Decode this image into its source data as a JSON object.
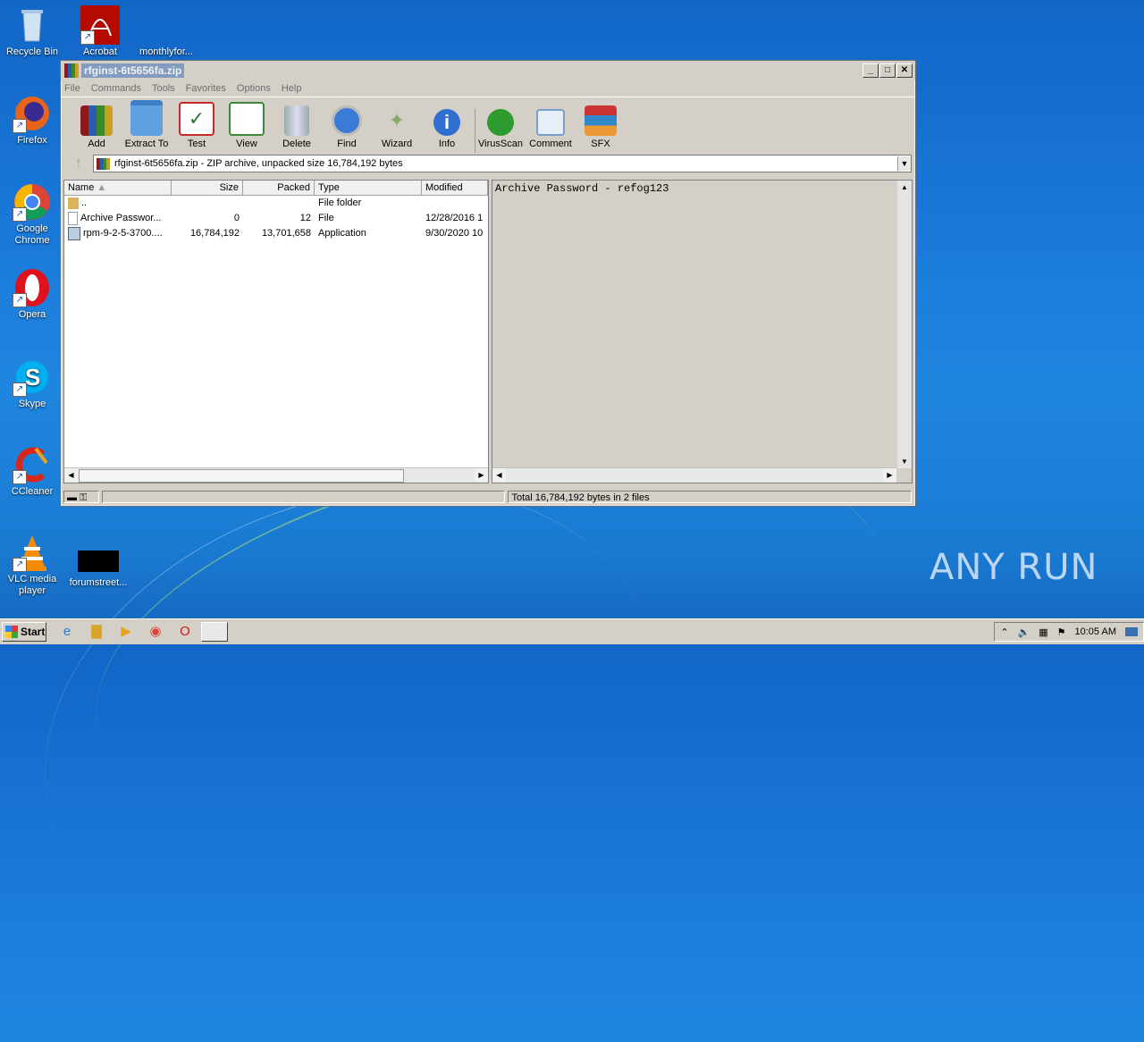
{
  "desktop": {
    "icons": [
      {
        "label": "Recycle Bin",
        "icon": "recycle-bin-icon"
      },
      {
        "label": "Acrobat",
        "icon": "acrobat-icon"
      },
      {
        "label": "monthlyfor...",
        "icon": "document-icon"
      },
      {
        "label": "Firefox",
        "icon": "firefox-icon"
      },
      {
        "label": "Google Chrome",
        "icon": "chrome-icon"
      },
      {
        "label": "Opera",
        "icon": "opera-icon"
      },
      {
        "label": "Skype",
        "icon": "skype-icon"
      },
      {
        "label": "CCleaner",
        "icon": "ccleaner-icon"
      },
      {
        "label": "VLC media player",
        "icon": "vlc-icon"
      },
      {
        "label": "forumstreet...",
        "icon": "black-file-icon"
      }
    ],
    "watermark": "ANY RUN"
  },
  "window": {
    "title": "rfginst-6t5656fa.zip",
    "menu": [
      "File",
      "Commands",
      "Tools",
      "Favorites",
      "Options",
      "Help"
    ],
    "toolbar": [
      {
        "label": "Add",
        "icon": "add-archive-icon"
      },
      {
        "label": "Extract To",
        "icon": "extract-folder-icon"
      },
      {
        "label": "Test",
        "icon": "test-clipboard-icon"
      },
      {
        "label": "View",
        "icon": "view-book-icon"
      },
      {
        "label": "Delete",
        "icon": "trash-icon"
      },
      {
        "label": "Find",
        "icon": "magnifier-icon"
      },
      {
        "label": "Wizard",
        "icon": "wand-icon"
      },
      {
        "label": "Info",
        "icon": "info-icon"
      },
      {
        "label": "VirusScan",
        "icon": "virus-icon"
      },
      {
        "label": "Comment",
        "icon": "comment-icon"
      },
      {
        "label": "SFX",
        "icon": "sfx-books-icon"
      }
    ],
    "address": "rfginst-6t5656fa.zip - ZIP archive, unpacked size 16,784,192 bytes",
    "columns": [
      "Name",
      "Size",
      "Packed",
      "Type",
      "Modified"
    ],
    "rows": [
      {
        "name": "..",
        "size": "",
        "packed": "",
        "type": "File folder",
        "modified": ""
      },
      {
        "name": "Archive Passwor...",
        "size": "0",
        "packed": "12",
        "type": "File",
        "modified": "12/28/2016 1"
      },
      {
        "name": "rpm-9-2-5-3700....",
        "size": "16,784,192",
        "packed": "13,701,658",
        "type": "Application",
        "modified": "9/30/2020 10"
      }
    ],
    "preview_text": "Archive Password - refog123",
    "status_text": "Total 16,784,192 bytes in 2 files"
  },
  "taskbar": {
    "start_label": "Start",
    "clock": "10:05 AM"
  },
  "colors": {
    "desktop_blue": "#1a78d8",
    "window_gray": "#d4d0c8"
  }
}
